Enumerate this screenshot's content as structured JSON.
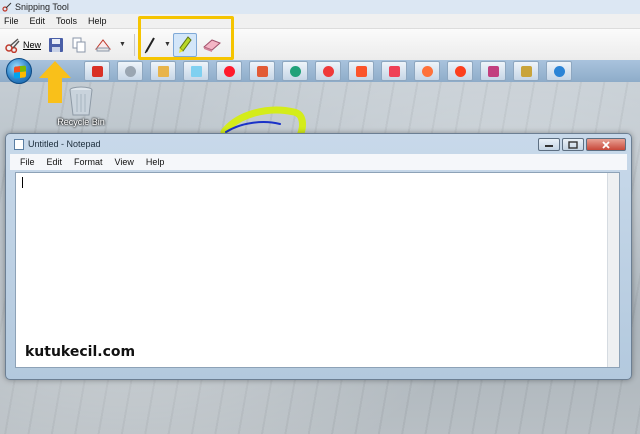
{
  "snipping_tool": {
    "title": "Snipping Tool",
    "menu": [
      "File",
      "Edit",
      "Tools",
      "Help"
    ],
    "toolbar": {
      "new_label": "New",
      "icons": [
        "scissors-icon",
        "save-icon",
        "copy-icon",
        "send-snip-icon",
        "pen-icon",
        "highlighter-icon",
        "eraser-icon"
      ]
    },
    "highlight_color": "#f5c400"
  },
  "taskbar": {
    "icons": [
      "download-icon",
      "settings-icon",
      "folder-icon",
      "notepad-icon",
      "opera-icon",
      "pdf-icon",
      "edge-icon",
      "vivaldi-icon",
      "brave-icon",
      "pocket-icon",
      "firefox-icon",
      "yandex-icon",
      "pin-icon",
      "pencil-icon",
      "edge-beta-icon"
    ]
  },
  "desktop": {
    "recycle_bin_label": "Recycle Bin"
  },
  "notepad": {
    "title": "Untitled - Notepad",
    "menu": [
      "File",
      "Edit",
      "Format",
      "View",
      "Help"
    ],
    "content": ""
  },
  "watermark": "kutukecil.com",
  "colors": {
    "arrow": "#f9c01a",
    "highlighter": "#d4ec1a",
    "pen": "#1a32c8"
  }
}
